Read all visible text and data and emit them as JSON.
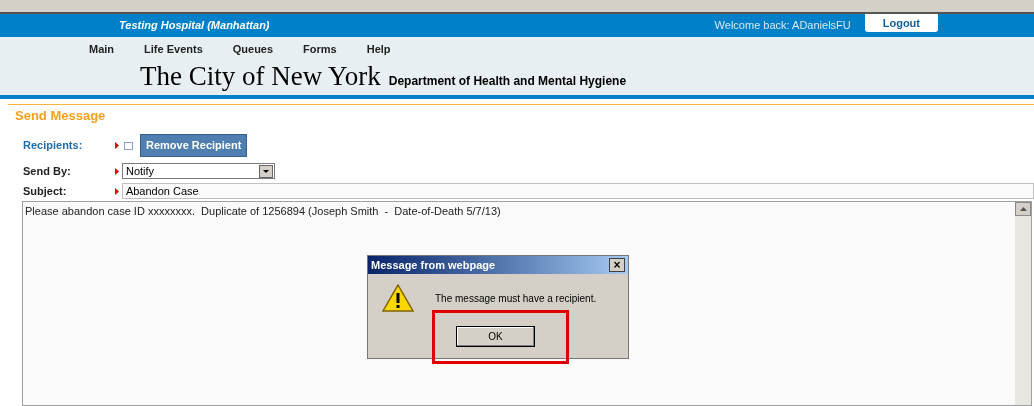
{
  "header": {
    "hospital": "Testing Hospital (Manhattan)",
    "welcome": "Welcome back: ADanielsFU",
    "logout": "Logout"
  },
  "nav": [
    "Main",
    "Life Events",
    "Queues",
    "Forms",
    "Help"
  ],
  "banner": {
    "title": "The City of New York",
    "subtitle": "Department of Health and Mental Hygiene"
  },
  "form": {
    "heading": "Send Message",
    "recipients": {
      "label": "Recipients:",
      "checked": false,
      "button": "Remove Recipient"
    },
    "send_by": {
      "label": "Send By:",
      "value": "Notify"
    },
    "subject": {
      "label": "Subject:",
      "value": "Abandon Case"
    },
    "body": "Please abandon case ID xxxxxxxx.  Duplicate of 1256894 (Joseph Smith  -  Date-of-Death 5/7/13)"
  },
  "dialog": {
    "title": "Message from webpage",
    "close": "×",
    "message": "The message must have a recipient.",
    "button": "OK",
    "highlighted": true
  }
}
